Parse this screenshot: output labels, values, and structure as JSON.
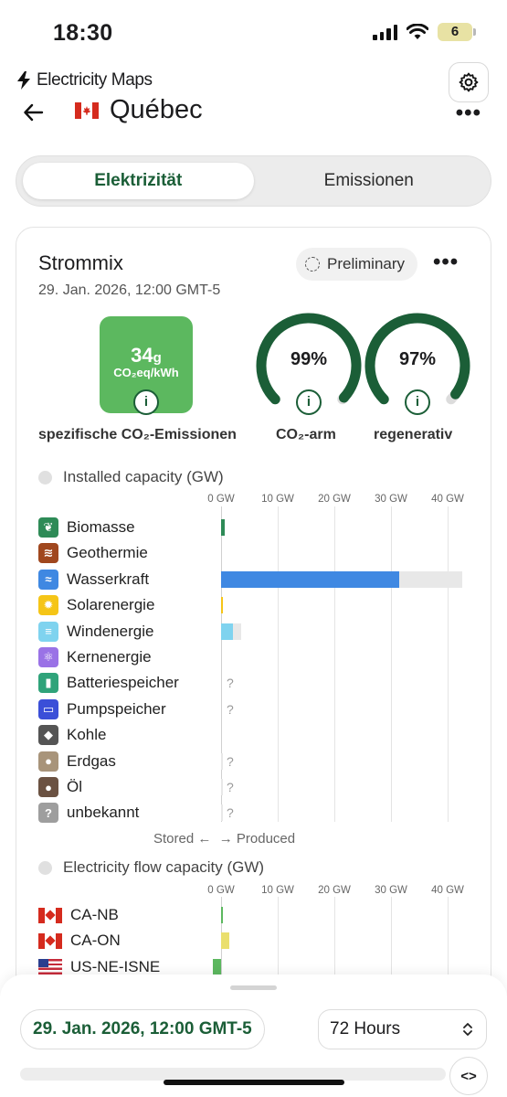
{
  "status_bar": {
    "time": "18:30",
    "battery": "6"
  },
  "app": {
    "brand": "Electricity Maps"
  },
  "zone": {
    "name": "Québec"
  },
  "tabs": {
    "electricity": "Elektrizität",
    "emissions": "Emissionen"
  },
  "card": {
    "title": "Strommix",
    "date": "29. Jan. 2026, 12:00 GMT-5",
    "badge": "Preliminary"
  },
  "metrics": {
    "co2_value": "34",
    "co2_value_unit": "g",
    "co2_unit": "CO₂eq/kWh",
    "co2_label": "spezifische CO₂-Emissionen",
    "low_carbon_pct": "99%",
    "low_carbon_label": "CO₂-arm",
    "low_carbon_fraction": 0.99,
    "renewable_pct": "97%",
    "renewable_label": "regenerativ",
    "renewable_fraction": 0.97,
    "colors": {
      "accent": "#1b5e37",
      "co2_tile": "#5cb85f",
      "gauge_track": "#dcdcdc"
    }
  },
  "installed": {
    "title": "Installed capacity (GW)",
    "axis_ticks": [
      "0 GW",
      "10 GW",
      "20 GW",
      "30 GW",
      "40 GW"
    ],
    "stored_label": "Stored ←",
    "produced_label": "→ Produced",
    "sources": [
      {
        "label": "Biomasse",
        "icon": "leaf-icon",
        "color": "#2e8b57",
        "production_gw": 0.6,
        "capacity_gw": 0.6,
        "unknown": false
      },
      {
        "label": "Geothermie",
        "icon": "geothermal-icon",
        "color": "#a0471e",
        "production_gw": 0,
        "capacity_gw": 0,
        "unknown": false
      },
      {
        "label": "Wasserkraft",
        "icon": "wave-icon",
        "color": "#3f88e2",
        "production_gw": 31.5,
        "capacity_gw": 42.5,
        "unknown": false
      },
      {
        "label": "Solarenergie",
        "icon": "sun-icon",
        "color": "#f5c517",
        "production_gw": 0.1,
        "capacity_gw": 0.1,
        "unknown": false
      },
      {
        "label": "Windenergie",
        "icon": "wind-icon",
        "color": "#7fd3ef",
        "production_gw": 2.1,
        "capacity_gw": 3.6,
        "unknown": false
      },
      {
        "label": "Kernenergie",
        "icon": "atom-icon",
        "color": "#9a72e6",
        "production_gw": 0,
        "capacity_gw": 0,
        "unknown": false
      },
      {
        "label": "Batteriespeicher",
        "icon": "battery-icon",
        "color": "#2fa37a",
        "production_gw": 0,
        "capacity_gw": 0,
        "unknown": true
      },
      {
        "label": "Pumpspeicher",
        "icon": "pump-icon",
        "color": "#3b4fd8",
        "production_gw": 0,
        "capacity_gw": 0,
        "unknown": true
      },
      {
        "label": "Kohle",
        "icon": "coal-icon",
        "color": "#555555",
        "production_gw": 0,
        "capacity_gw": 0,
        "unknown": false
      },
      {
        "label": "Erdgas",
        "icon": "gas-icon",
        "color": "#a8947a",
        "production_gw": 0,
        "capacity_gw": 0.1,
        "unknown": true
      },
      {
        "label": "Öl",
        "icon": "oil-icon",
        "color": "#6b5242",
        "production_gw": 0,
        "capacity_gw": 0.1,
        "unknown": true
      },
      {
        "label": "unbekannt",
        "icon": "question-icon",
        "color": "#9e9e9e",
        "production_gw": 0,
        "capacity_gw": 0.3,
        "unknown": true
      }
    ]
  },
  "flows": {
    "title": "Electricity flow capacity (GW)",
    "axis_ticks": [
      "0 GW",
      "10 GW",
      "20 GW",
      "30 GW",
      "40 GW"
    ],
    "items": [
      {
        "label": "CA-NB",
        "flag": "ca-flag-icon",
        "value_gw": 0.3,
        "color": "#5cb85f"
      },
      {
        "label": "CA-ON",
        "flag": "ca-flag-icon",
        "value_gw": 1.4,
        "color": "#eadf6e"
      },
      {
        "label": "US-NE-ISNE",
        "flag": "us-flag-icon",
        "value_gw": -1.5,
        "color": "#5cb85f"
      }
    ]
  },
  "bottom": {
    "date": "29. Jan. 2026, 12:00 GMT-5",
    "range": "72 Hours"
  }
}
